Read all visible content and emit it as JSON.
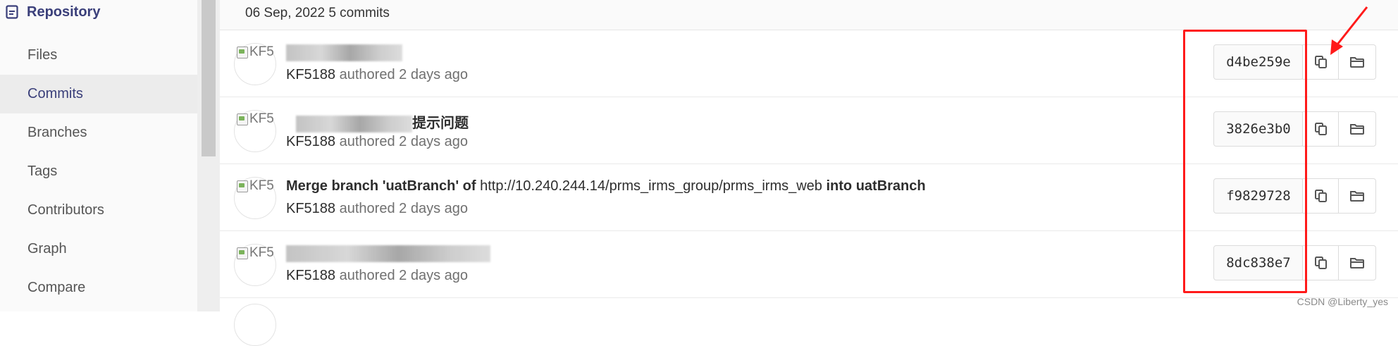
{
  "sidebar": {
    "header": {
      "label": "Repository",
      "icon": "document-icon"
    },
    "items": [
      {
        "label": "Files"
      },
      {
        "label": "Commits"
      },
      {
        "label": "Branches"
      },
      {
        "label": "Tags"
      },
      {
        "label": "Contributors"
      },
      {
        "label": "Graph"
      },
      {
        "label": "Compare"
      }
    ],
    "active": "Commits"
  },
  "commits_header": {
    "date_label": "06 Sep, 2022 5 commits"
  },
  "commits": [
    {
      "avatar_alt": "KF5",
      "title_suffix": "",
      "author": "KF5188",
      "authored_text": "authored 2 days ago",
      "sha": "d4be259e"
    },
    {
      "avatar_alt": "KF5",
      "title_suffix": "提示问题",
      "author": "KF5188",
      "authored_text": "authored 2 days ago",
      "sha": "3826e3b0"
    },
    {
      "avatar_alt": "KF5",
      "title_prefix": "Merge branch 'uatBranch' of",
      "title_url": "http://10.240.244.14/prms_irms_group/prms_irms_web",
      "title_suffix": "into uatBranch",
      "author": "KF5188",
      "authored_text": "authored 2 days ago",
      "sha": "f9829728"
    },
    {
      "avatar_alt": "KF5",
      "title_suffix": "",
      "author": "KF5188",
      "authored_text": "authored 2 days ago",
      "sha": "8dc838e7"
    }
  ],
  "credit": "CSDN @Liberty_yes",
  "colors": {
    "annotation": "#ff1a1a",
    "active_text": "#3a3f7a"
  }
}
